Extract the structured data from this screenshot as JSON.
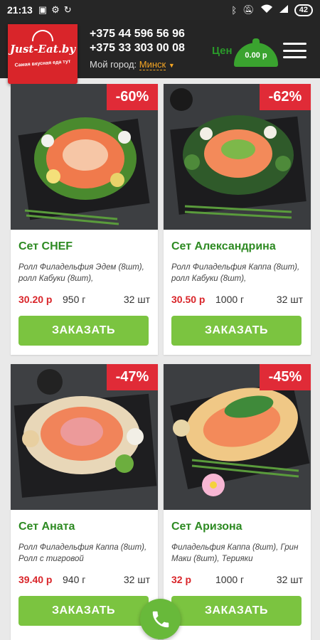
{
  "status_bar": {
    "time": "21:13",
    "battery": "42"
  },
  "header": {
    "logo_text": "Just-Eat.by",
    "logo_slogan": "Самая вкусная еда тут",
    "phone_1": "+375 44 596 56 96",
    "phone_2": "+375 33 303 00 08",
    "city_label": "Мой город:",
    "city_value": "Минск",
    "partial_text": "Цен",
    "cart_total": "0.00 р"
  },
  "products": [
    {
      "title": "Сет CHEF",
      "discount": "-60%",
      "description": "Ролл Филадельфия Эдем (8шт), ролл Кабуки (8шт),",
      "price": "30.20 р",
      "weight": "950 г",
      "pieces": "32 шт",
      "button": "ЗАКАЗАТЬ"
    },
    {
      "title": "Сет Александрина",
      "discount": "-62%",
      "description": "Ролл Филадельфия Каппа (8шт), ролл Кабуки (8шт),",
      "price": "30.50 р",
      "weight": "1000 г",
      "pieces": "32 шт",
      "button": "ЗАКАЗАТЬ"
    },
    {
      "title": "Сет Аната",
      "discount": "-47%",
      "description": "Ролл Филадельфия Каппа (8шт), Ролл с тигровой",
      "price": "39.40 р",
      "weight": "940 г",
      "pieces": "32 шт",
      "button": "ЗАКАЗАТЬ"
    },
    {
      "title": "Сет Аризона",
      "discount": "-45%",
      "description": "Филадельфия Каппа (8шт), Грин Маки (8шт), Терияки",
      "price": "32 р",
      "weight": "1000 г",
      "pieces": "32 шт",
      "button": "ЗАКАЗАТЬ"
    }
  ],
  "colors": {
    "accent_green": "#7bc440",
    "price_red": "#d9252a",
    "badge_red": "#e02b37",
    "header_bg": "#252525"
  }
}
